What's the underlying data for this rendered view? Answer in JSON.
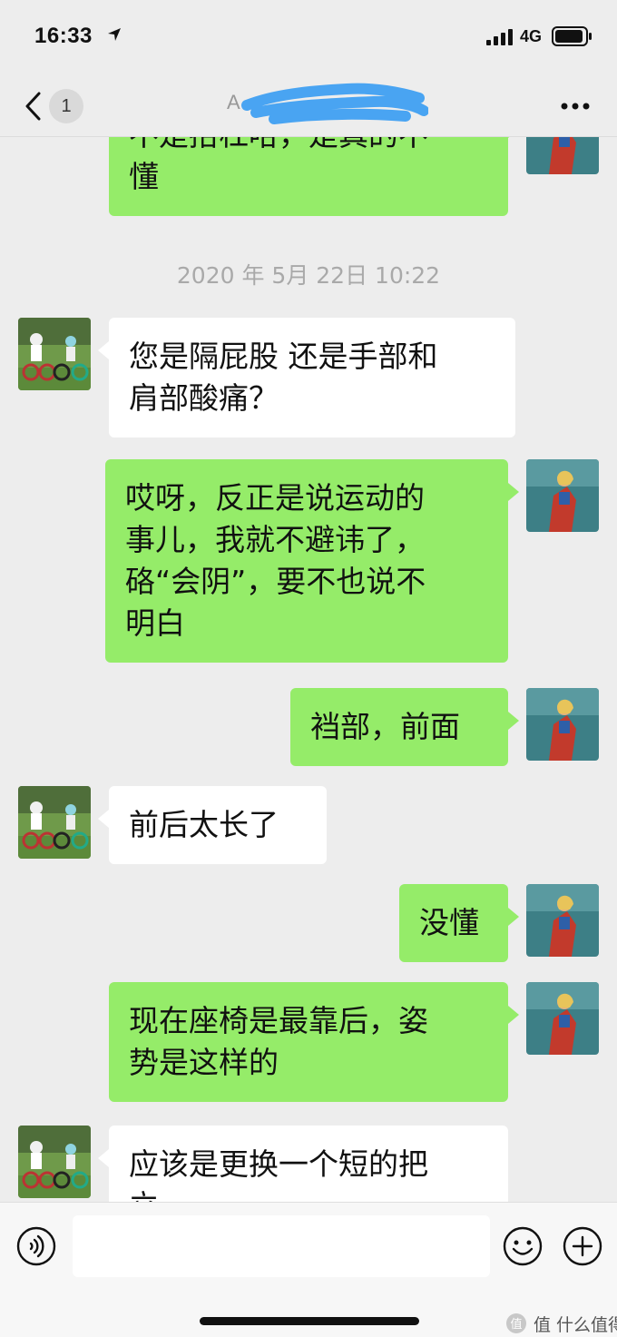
{
  "status_bar": {
    "time": "16:33",
    "network": "4G"
  },
  "nav": {
    "unread_count": "1",
    "chat_title": "A"
  },
  "timestamp": "2020 年 5月 22日 10:22",
  "messages": [
    {
      "sender": "me",
      "lines": [
        "不是抬杠哈，是真的不",
        "懂"
      ]
    },
    {
      "sender": "contact",
      "lines": [
        "您是隔屁股 还是手部和",
        "肩部酸痛？"
      ]
    },
    {
      "sender": "me",
      "lines": [
        "哎呀，反正是说运动的",
        "事儿，我就不避讳了，",
        "硌“会阴”，要不也说不",
        "明白"
      ]
    },
    {
      "sender": "me",
      "lines": [
        "裆部，前面"
      ]
    },
    {
      "sender": "contact",
      "lines": [
        "前后太长了"
      ]
    },
    {
      "sender": "me",
      "lines": [
        "没懂"
      ]
    },
    {
      "sender": "me",
      "lines": [
        "现在座椅是最靠后，姿",
        "势是这样的"
      ]
    },
    {
      "sender": "contact",
      "lines": [
        "应该是更换一个短的把",
        "立"
      ]
    }
  ],
  "input": {
    "placeholder": ""
  },
  "watermark": "值 什么值得买",
  "colors": {
    "outgoing_bubble": "#95ec69",
    "incoming_bubble": "#ffffff",
    "background": "#ededed"
  }
}
